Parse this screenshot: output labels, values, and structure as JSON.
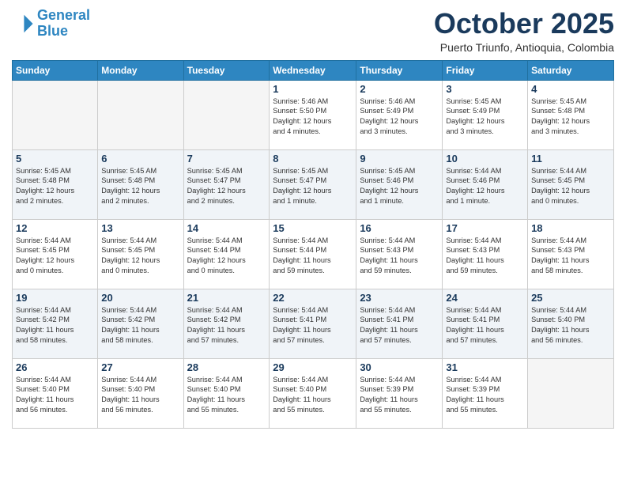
{
  "header": {
    "logo_line1": "General",
    "logo_line2": "Blue",
    "month_title": "October 2025",
    "location": "Puerto Triunfo, Antioquia, Colombia"
  },
  "days_of_week": [
    "Sunday",
    "Monday",
    "Tuesday",
    "Wednesday",
    "Thursday",
    "Friday",
    "Saturday"
  ],
  "weeks": [
    [
      {
        "day": "",
        "info": ""
      },
      {
        "day": "",
        "info": ""
      },
      {
        "day": "",
        "info": ""
      },
      {
        "day": "1",
        "info": "Sunrise: 5:46 AM\nSunset: 5:50 PM\nDaylight: 12 hours\nand 4 minutes."
      },
      {
        "day": "2",
        "info": "Sunrise: 5:46 AM\nSunset: 5:49 PM\nDaylight: 12 hours\nand 3 minutes."
      },
      {
        "day": "3",
        "info": "Sunrise: 5:45 AM\nSunset: 5:49 PM\nDaylight: 12 hours\nand 3 minutes."
      },
      {
        "day": "4",
        "info": "Sunrise: 5:45 AM\nSunset: 5:48 PM\nDaylight: 12 hours\nand 3 minutes."
      }
    ],
    [
      {
        "day": "5",
        "info": "Sunrise: 5:45 AM\nSunset: 5:48 PM\nDaylight: 12 hours\nand 2 minutes."
      },
      {
        "day": "6",
        "info": "Sunrise: 5:45 AM\nSunset: 5:48 PM\nDaylight: 12 hours\nand 2 minutes."
      },
      {
        "day": "7",
        "info": "Sunrise: 5:45 AM\nSunset: 5:47 PM\nDaylight: 12 hours\nand 2 minutes."
      },
      {
        "day": "8",
        "info": "Sunrise: 5:45 AM\nSunset: 5:47 PM\nDaylight: 12 hours\nand 1 minute."
      },
      {
        "day": "9",
        "info": "Sunrise: 5:45 AM\nSunset: 5:46 PM\nDaylight: 12 hours\nand 1 minute."
      },
      {
        "day": "10",
        "info": "Sunrise: 5:44 AM\nSunset: 5:46 PM\nDaylight: 12 hours\nand 1 minute."
      },
      {
        "day": "11",
        "info": "Sunrise: 5:44 AM\nSunset: 5:45 PM\nDaylight: 12 hours\nand 0 minutes."
      }
    ],
    [
      {
        "day": "12",
        "info": "Sunrise: 5:44 AM\nSunset: 5:45 PM\nDaylight: 12 hours\nand 0 minutes."
      },
      {
        "day": "13",
        "info": "Sunrise: 5:44 AM\nSunset: 5:45 PM\nDaylight: 12 hours\nand 0 minutes."
      },
      {
        "day": "14",
        "info": "Sunrise: 5:44 AM\nSunset: 5:44 PM\nDaylight: 12 hours\nand 0 minutes."
      },
      {
        "day": "15",
        "info": "Sunrise: 5:44 AM\nSunset: 5:44 PM\nDaylight: 11 hours\nand 59 minutes."
      },
      {
        "day": "16",
        "info": "Sunrise: 5:44 AM\nSunset: 5:43 PM\nDaylight: 11 hours\nand 59 minutes."
      },
      {
        "day": "17",
        "info": "Sunrise: 5:44 AM\nSunset: 5:43 PM\nDaylight: 11 hours\nand 59 minutes."
      },
      {
        "day": "18",
        "info": "Sunrise: 5:44 AM\nSunset: 5:43 PM\nDaylight: 11 hours\nand 58 minutes."
      }
    ],
    [
      {
        "day": "19",
        "info": "Sunrise: 5:44 AM\nSunset: 5:42 PM\nDaylight: 11 hours\nand 58 minutes."
      },
      {
        "day": "20",
        "info": "Sunrise: 5:44 AM\nSunset: 5:42 PM\nDaylight: 11 hours\nand 58 minutes."
      },
      {
        "day": "21",
        "info": "Sunrise: 5:44 AM\nSunset: 5:42 PM\nDaylight: 11 hours\nand 57 minutes."
      },
      {
        "day": "22",
        "info": "Sunrise: 5:44 AM\nSunset: 5:41 PM\nDaylight: 11 hours\nand 57 minutes."
      },
      {
        "day": "23",
        "info": "Sunrise: 5:44 AM\nSunset: 5:41 PM\nDaylight: 11 hours\nand 57 minutes."
      },
      {
        "day": "24",
        "info": "Sunrise: 5:44 AM\nSunset: 5:41 PM\nDaylight: 11 hours\nand 57 minutes."
      },
      {
        "day": "25",
        "info": "Sunrise: 5:44 AM\nSunset: 5:40 PM\nDaylight: 11 hours\nand 56 minutes."
      }
    ],
    [
      {
        "day": "26",
        "info": "Sunrise: 5:44 AM\nSunset: 5:40 PM\nDaylight: 11 hours\nand 56 minutes."
      },
      {
        "day": "27",
        "info": "Sunrise: 5:44 AM\nSunset: 5:40 PM\nDaylight: 11 hours\nand 56 minutes."
      },
      {
        "day": "28",
        "info": "Sunrise: 5:44 AM\nSunset: 5:40 PM\nDaylight: 11 hours\nand 55 minutes."
      },
      {
        "day": "29",
        "info": "Sunrise: 5:44 AM\nSunset: 5:40 PM\nDaylight: 11 hours\nand 55 minutes."
      },
      {
        "day": "30",
        "info": "Sunrise: 5:44 AM\nSunset: 5:39 PM\nDaylight: 11 hours\nand 55 minutes."
      },
      {
        "day": "31",
        "info": "Sunrise: 5:44 AM\nSunset: 5:39 PM\nDaylight: 11 hours\nand 55 minutes."
      },
      {
        "day": "",
        "info": ""
      }
    ]
  ]
}
